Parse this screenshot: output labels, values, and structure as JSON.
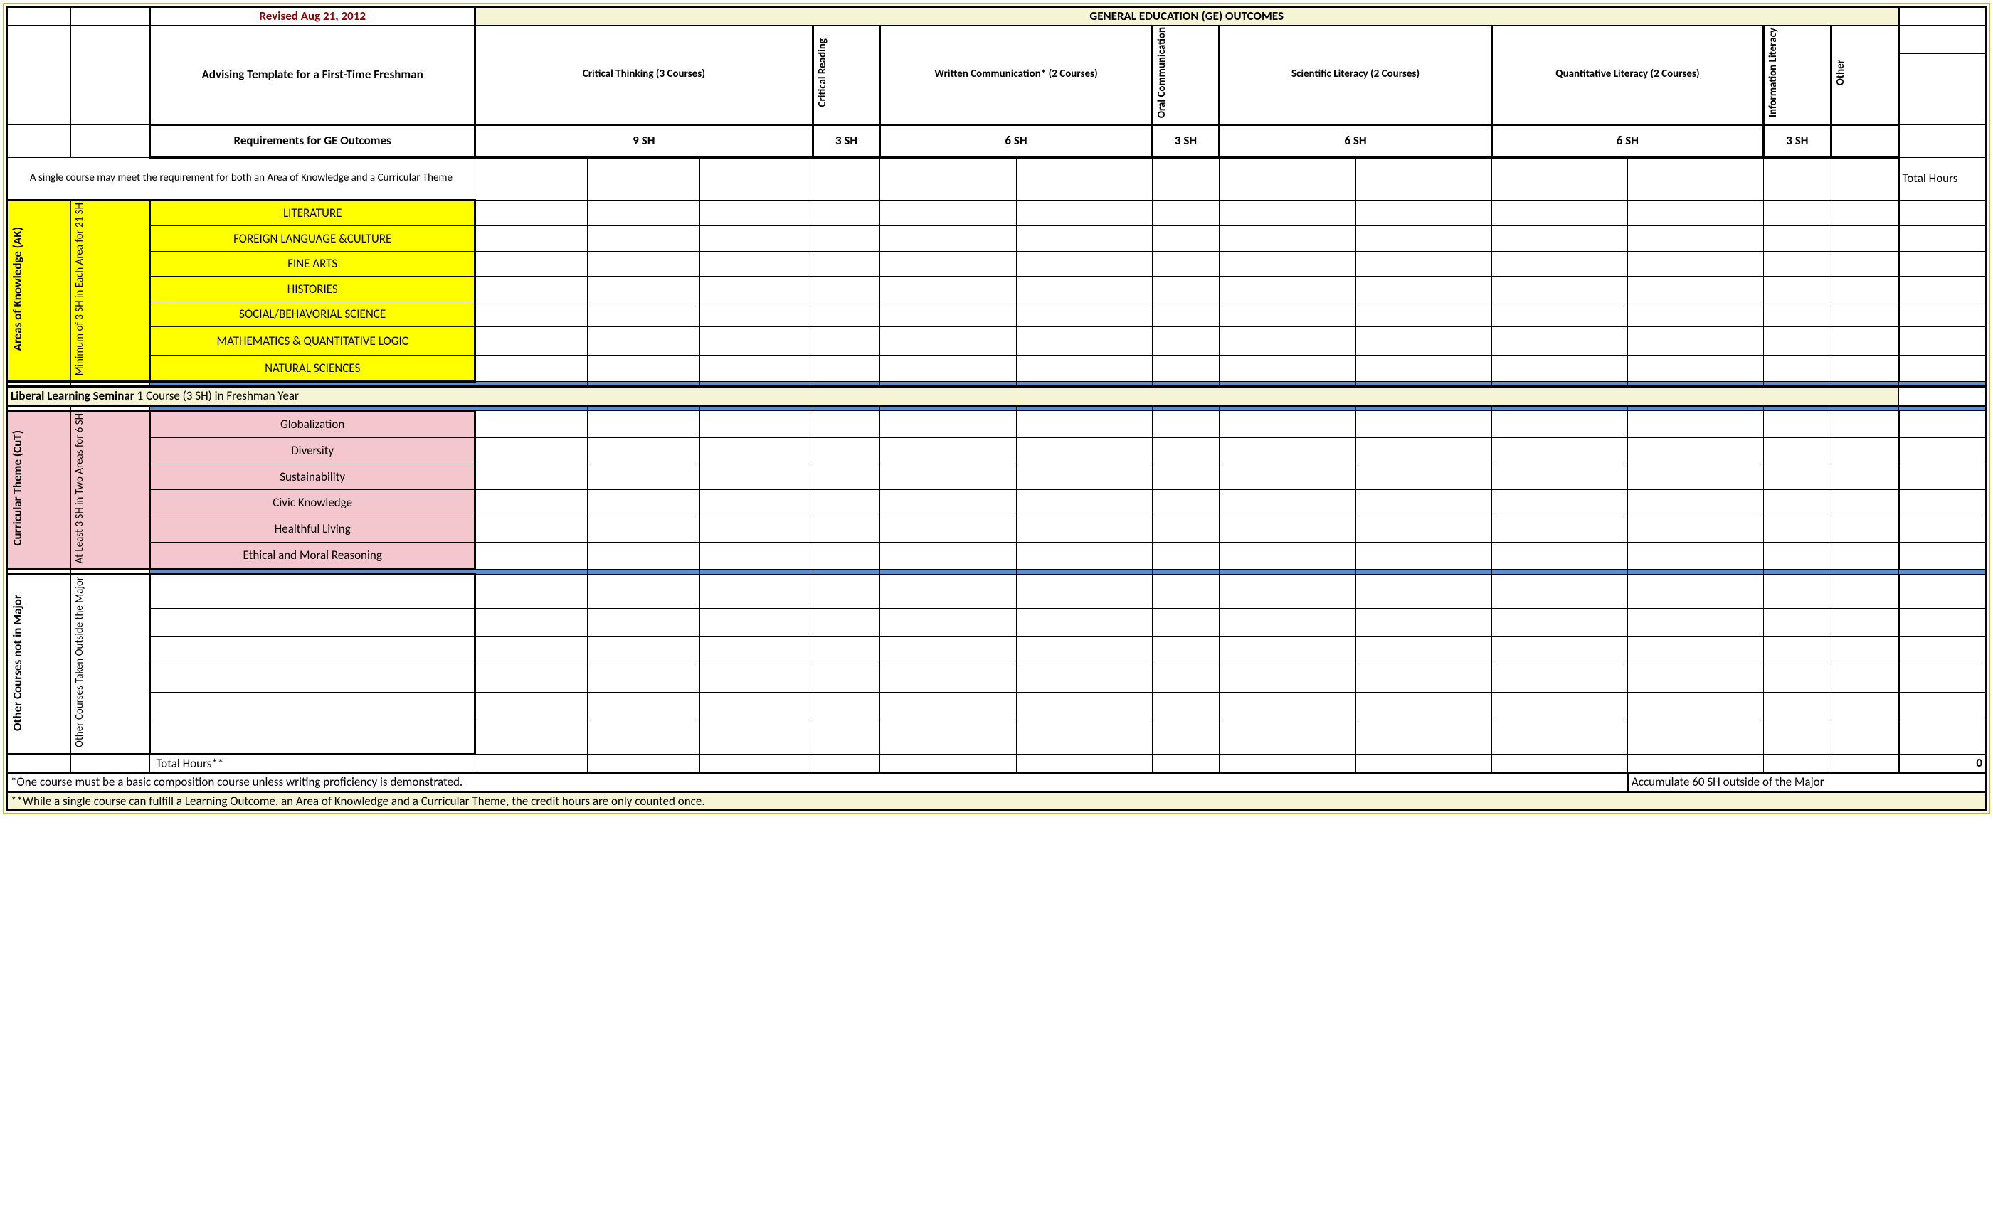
{
  "header": {
    "revised": "Revised Aug 21, 2012",
    "ge_outcomes_title": "GENERAL EDUCATION (GE) OUTCOMES",
    "advising_title": "Advising Template for a First-Time Freshman",
    "requirements_label": "Requirements for GE Outcomes"
  },
  "outcome_cols": [
    {
      "label": "Critical Thinking (3 Courses)",
      "sh": "9 SH",
      "span": 3
    },
    {
      "label": "Critical Reading",
      "sh": "3 SH",
      "span": 1,
      "vert": true
    },
    {
      "label": "Written Communication*  (2 Courses)",
      "sh": "6 SH",
      "span": 2
    },
    {
      "label": "Oral Communication",
      "sh": "3 SH",
      "span": 1,
      "vert": true
    },
    {
      "label": "Scientific Literacy          (2 Courses)",
      "sh": "6 SH",
      "span": 2
    },
    {
      "label": "Quantitative Literacy      (2 Courses)",
      "sh": "6 SH",
      "span": 2
    },
    {
      "label": "Information Literacy",
      "sh": "3 SH",
      "span": 1,
      "vert": true
    },
    {
      "label": "Other",
      "sh": "",
      "span": 1,
      "vert": true
    }
  ],
  "note_course": "A single course may meet the requirement for both an Area of Knowledge and a Curricular Theme",
  "total_hours_label": "Total Hours",
  "ak": {
    "section_label": "Areas of Knowledge (AK)",
    "req_label": "Minimum of 3 SH in Each Area for 21 SH",
    "rows": [
      "LITERATURE",
      "FOREIGN LANGUAGE &CULTURE",
      "FINE ARTS",
      "HISTORIES",
      "SOCIAL/BEHAVORIAL SCIENCE",
      "MATHEMATICS & QUANTITATIVE LOGIC",
      "NATURAL SCIENCES"
    ]
  },
  "lls": {
    "label": "Liberal Learning Seminar",
    "detail": "  1 Course (3 SH) in Freshman Year"
  },
  "cut": {
    "section_label": "Curricular Theme (CuT)",
    "req_label": "At Least 3 SH in Two Areas for 6 SH",
    "rows": [
      "Globalization",
      "Diversity",
      "Sustainability",
      "Civic Knowledge",
      "Healthful Living",
      "Ethical and Moral Reasoning"
    ]
  },
  "other_courses": {
    "section_label": "Other Courses not in Major",
    "sub_label": "Other Courses Taken Outside the Major"
  },
  "total_hours_row": "Total Hours**",
  "total_hours_value": "0",
  "footnote1a": "*One course must be a basic composition course ",
  "footnote1b": "unless writing proficiency",
  "footnote1c": " is demonstrated.",
  "footnote_accum": "Accumulate 60 SH outside of the Major",
  "footnote2": "**While a single course can fulfill a Learning Outcome, an Area of Knowledge and a Curricular Theme, the credit hours are only counted once."
}
